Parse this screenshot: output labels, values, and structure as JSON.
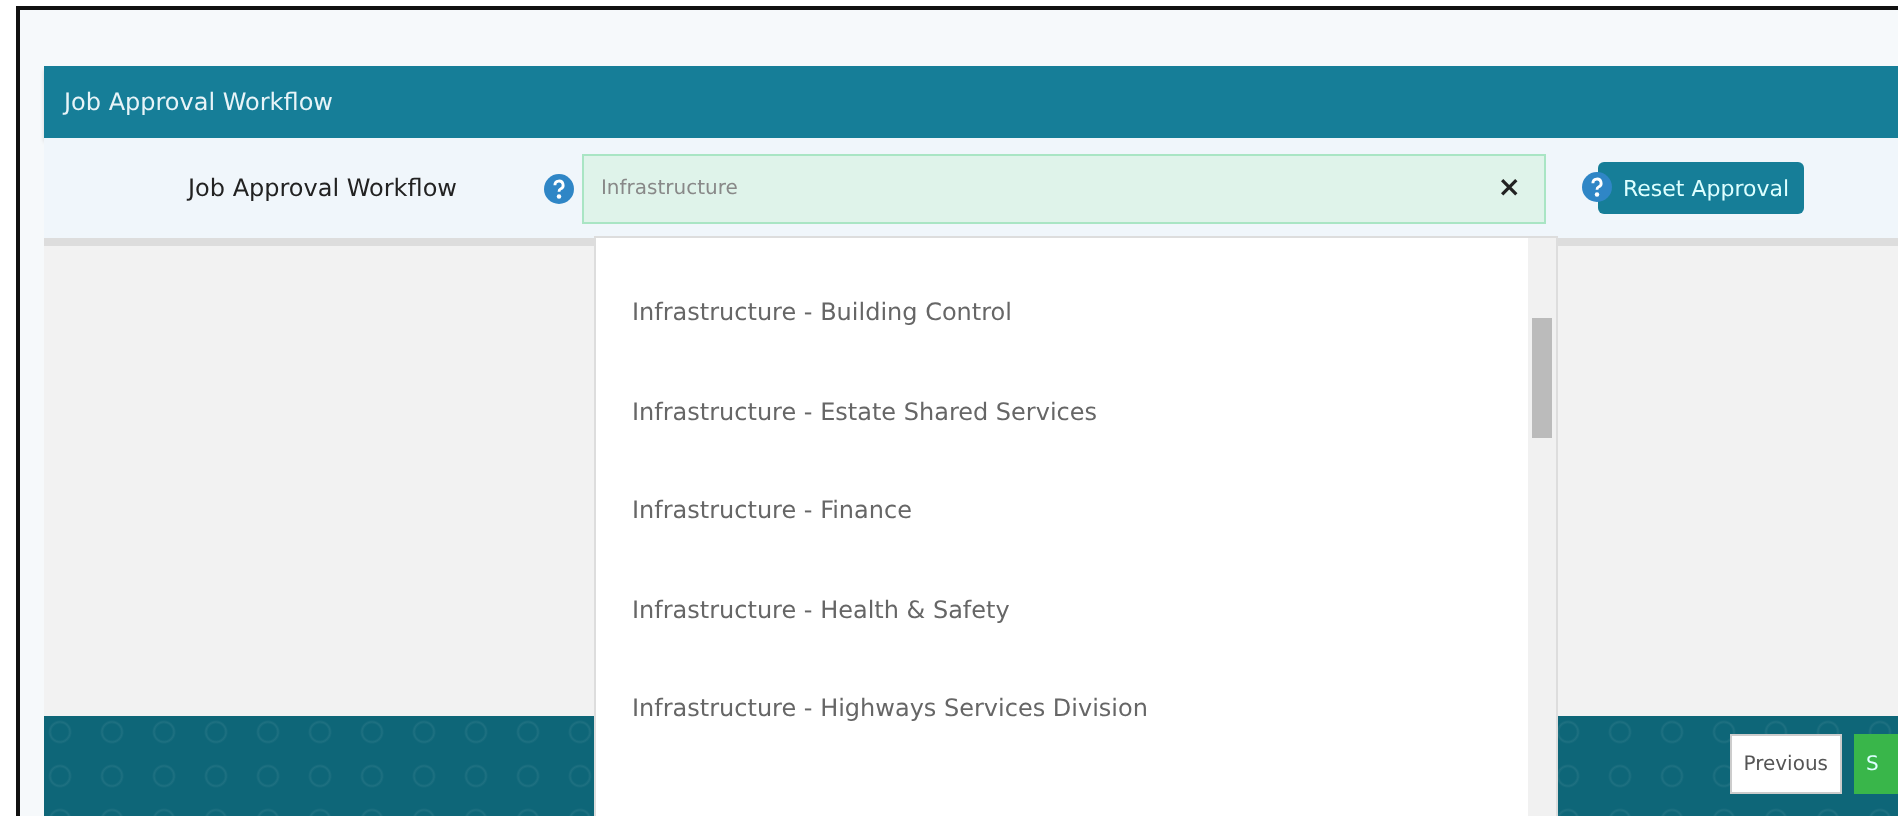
{
  "section": {
    "title": "Job Approval Workflow"
  },
  "field": {
    "label": "Job Approval Workflow",
    "value": "Infrastructure",
    "clear": "×",
    "expanded": true
  },
  "options": [
    {
      "label": "Infrastructure - Building Control",
      "selected": false
    },
    {
      "label": "Infrastructure - Estate Shared Services",
      "selected": false
    },
    {
      "label": "Infrastructure - Finance",
      "selected": false
    },
    {
      "label": "Infrastructure - Health & Safety",
      "selected": false
    },
    {
      "label": "Infrastructure - Highways Services Division",
      "selected": false
    }
  ],
  "reset_button": "Reset Approval",
  "footer": {
    "buttons": [
      {
        "label": "Previous",
        "kind": "plain"
      },
      {
        "label": "S",
        "kind": "primary"
      }
    ]
  }
}
